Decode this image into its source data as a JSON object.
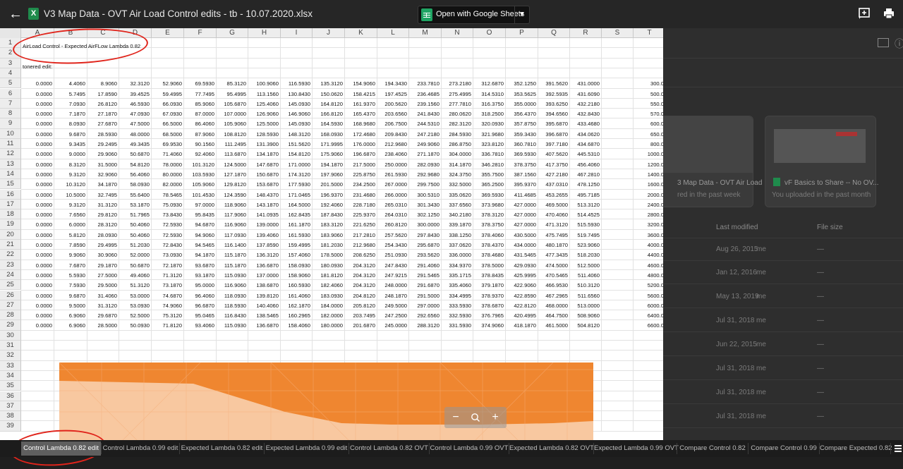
{
  "topbar": {
    "back_icon": "arrow-left-icon",
    "file_icon_letter": "X",
    "title": "V3 Map Data - OVT Air Load Control edits - tb - 10.07.2020.xlsx",
    "open_with_label": "Open with Google Sheets",
    "add_comment_icon": "add-comment-icon",
    "print_icon": "print-icon"
  },
  "sheet": {
    "columns": [
      "A",
      "B",
      "C",
      "D",
      "E",
      "F",
      "G",
      "H",
      "I",
      "J",
      "K",
      "L",
      "M",
      "N",
      "O",
      "P",
      "Q",
      "R",
      "S",
      "T"
    ],
    "row_numbers": [
      "1",
      "2",
      "3",
      "4",
      "5",
      "6",
      "7",
      "8",
      "9",
      "10",
      "11",
      "12",
      "13",
      "14",
      "15",
      "16",
      "17",
      "18",
      "19",
      "20",
      "21",
      "22",
      "23",
      "24",
      "25",
      "26",
      "27",
      "28",
      "29",
      "30",
      "31",
      "32",
      "33",
      "34",
      "35",
      "36",
      "37",
      "38",
      "39"
    ],
    "a1": "AirLoad Control - Expected AirFLow Lambda 0.82",
    "a3": "tonered edit:",
    "data_rows": [
      [
        "0.0000",
        "4.4060",
        "8.9060",
        "32.3120",
        "52.9060",
        "69.5930",
        "85.3120",
        "100.9060",
        "116.5930",
        "135.3120",
        "154.9060",
        "194.3430",
        "233.7810",
        "273.2180",
        "312.6870",
        "352.1250",
        "391.5620",
        "431.0000",
        "",
        "300.0"
      ],
      [
        "0.0000",
        "5.7495",
        "17.8590",
        "39.4525",
        "59.4995",
        "77.7495",
        "95.4995",
        "113.1560",
        "130.8430",
        "150.0620",
        "158.4215",
        "197.4525",
        "236.4685",
        "275.4995",
        "314.5310",
        "353.5625",
        "392.5935",
        "431.6090",
        "",
        "500.0"
      ],
      [
        "0.0000",
        "7.0930",
        "26.8120",
        "46.5930",
        "66.0930",
        "85.9060",
        "105.6870",
        "125.4060",
        "145.0930",
        "164.8120",
        "161.9370",
        "200.5620",
        "239.1560",
        "277.7810",
        "316.3750",
        "355.0000",
        "393.6250",
        "432.2180",
        "",
        "550.0"
      ],
      [
        "0.0000",
        "7.1870",
        "27.1870",
        "47.0930",
        "67.0930",
        "87.0000",
        "107.0000",
        "126.9060",
        "146.9060",
        "166.8120",
        "165.4370",
        "203.6560",
        "241.8430",
        "280.0620",
        "318.2500",
        "356.4370",
        "394.6560",
        "432.8430",
        "",
        "570.0"
      ],
      [
        "0.0000",
        "8.0930",
        "27.6870",
        "47.5000",
        "66.5000",
        "86.4060",
        "105.9060",
        "125.5000",
        "145.0930",
        "164.5930",
        "168.9680",
        "206.7500",
        "244.5310",
        "282.3120",
        "320.0930",
        "357.8750",
        "395.6870",
        "433.4680",
        "",
        "600.0"
      ],
      [
        "0.0000",
        "9.6870",
        "28.5930",
        "48.0000",
        "68.5000",
        "87.9060",
        "108.8120",
        "128.5930",
        "148.3120",
        "168.0930",
        "172.4680",
        "209.8430",
        "247.2180",
        "284.5930",
        "321.9680",
        "359.3430",
        "396.6870",
        "434.0620",
        "",
        "650.0"
      ],
      [
        "0.0000",
        "9.3435",
        "29.2495",
        "49.3435",
        "69.9530",
        "90.1560",
        "111.2495",
        "131.3900",
        "151.5620",
        "171.9995",
        "176.0000",
        "212.9680",
        "249.9060",
        "286.8750",
        "323.8120",
        "360.7810",
        "397.7180",
        "434.6870",
        "",
        "800.0"
      ],
      [
        "0.0000",
        "9.0000",
        "29.9060",
        "50.6870",
        "71.4060",
        "92.4060",
        "113.6870",
        "134.1870",
        "154.8120",
        "175.9060",
        "196.6870",
        "238.4060",
        "271.1870",
        "304.0000",
        "336.7810",
        "369.5930",
        "407.5620",
        "445.5310",
        "",
        "1000.0"
      ],
      [
        "0.0000",
        "8.3120",
        "31.5000",
        "54.8120",
        "78.0000",
        "101.3120",
        "124.5000",
        "147.6870",
        "171.0000",
        "194.1870",
        "217.5000",
        "250.0000",
        "282.0930",
        "314.1870",
        "346.2810",
        "378.3750",
        "417.3750",
        "456.4060",
        "",
        "1200.0"
      ],
      [
        "0.0000",
        "9.3120",
        "32.9060",
        "56.4060",
        "80.0000",
        "103.5930",
        "127.1870",
        "150.6870",
        "174.3120",
        "197.9060",
        "225.8750",
        "261.5930",
        "292.9680",
        "324.3750",
        "355.7500",
        "387.1560",
        "427.2180",
        "467.2810",
        "",
        "1400.0"
      ],
      [
        "0.0000",
        "10.3120",
        "34.1870",
        "58.0930",
        "82.0000",
        "105.9060",
        "129.8120",
        "153.6870",
        "177.5930",
        "201.5000",
        "234.2500",
        "267.0000",
        "299.7500",
        "332.5000",
        "365.2500",
        "395.9370",
        "437.0310",
        "478.1250",
        "",
        "1600.0"
      ],
      [
        "0.0000",
        "10.5000",
        "32.7495",
        "55.6400",
        "78.5465",
        "101.4530",
        "124.3590",
        "148.4370",
        "171.0465",
        "196.9370",
        "231.4680",
        "266.0000",
        "300.5310",
        "335.0620",
        "369.5930",
        "411.4685",
        "453.2655",
        "495.7185",
        "",
        "2000.0"
      ],
      [
        "0.0000",
        "9.3120",
        "31.3120",
        "53.1870",
        "75.0930",
        "97.0000",
        "118.9060",
        "143.1870",
        "164.5000",
        "192.4060",
        "228.7180",
        "265.0310",
        "301.3430",
        "337.6560",
        "373.9680",
        "427.0000",
        "469.5000",
        "513.3120",
        "",
        "2400.0"
      ],
      [
        "0.0000",
        "7.6560",
        "29.8120",
        "51.7965",
        "73.8430",
        "95.8435",
        "117.9060",
        "141.0935",
        "162.8435",
        "187.8430",
        "225.9370",
        "264.0310",
        "302.1250",
        "340.2180",
        "378.3120",
        "427.0000",
        "470.4060",
        "514.4525",
        "",
        "2800.0"
      ],
      [
        "0.0000",
        "6.0000",
        "28.3120",
        "50.4060",
        "72.5930",
        "94.6870",
        "116.9060",
        "139.0000",
        "161.1870",
        "183.3120",
        "221.6250",
        "260.8120",
        "300.0000",
        "339.1870",
        "378.3750",
        "427.0000",
        "471.3120",
        "515.5930",
        "",
        "3200.0"
      ],
      [
        "0.0000",
        "5.8120",
        "28.0930",
        "50.4060",
        "72.5930",
        "94.9060",
        "117.0930",
        "139.4060",
        "161.5930",
        "183.9060",
        "217.2810",
        "257.5620",
        "297.8430",
        "338.1250",
        "378.4060",
        "430.5000",
        "475.7495",
        "519.7495",
        "",
        "3600.0"
      ],
      [
        "0.0000",
        "7.8590",
        "29.4995",
        "51.2030",
        "72.8430",
        "94.5465",
        "116.1400",
        "137.8590",
        "159.4995",
        "181.2030",
        "212.9680",
        "254.3430",
        "295.6870",
        "337.0620",
        "378.4370",
        "434.0000",
        "480.1870",
        "523.9060",
        "",
        "4000.0"
      ],
      [
        "0.0000",
        "9.9060",
        "30.9060",
        "52.0000",
        "73.0930",
        "94.1870",
        "115.1870",
        "136.3120",
        "157.4060",
        "178.5000",
        "208.6250",
        "251.0930",
        "293.5620",
        "336.0000",
        "378.4680",
        "431.5465",
        "477.3435",
        "518.2030",
        "",
        "4400.0"
      ],
      [
        "0.0000",
        "7.6870",
        "29.1870",
        "50.6870",
        "72.1870",
        "93.6870",
        "115.1870",
        "136.6870",
        "158.0930",
        "180.0930",
        "204.3120",
        "247.8430",
        "291.4060",
        "334.9370",
        "378.5000",
        "429.0930",
        "474.5000",
        "512.5000",
        "",
        "4600.0"
      ],
      [
        "0.0000",
        "5.5930",
        "27.5000",
        "49.4060",
        "71.3120",
        "93.1870",
        "115.0930",
        "137.0000",
        "158.9060",
        "181.8120",
        "204.3120",
        "247.9215",
        "291.5465",
        "335.1715",
        "378.8435",
        "425.9995",
        "470.5465",
        "511.4060",
        "",
        "4800.0"
      ],
      [
        "0.0000",
        "7.5930",
        "29.5000",
        "51.3120",
        "73.1870",
        "95.0000",
        "116.9060",
        "138.6870",
        "160.5930",
        "182.4060",
        "204.3120",
        "248.0000",
        "291.6870",
        "335.4060",
        "379.1870",
        "422.9060",
        "466.9530",
        "510.3120",
        "",
        "5200.0"
      ],
      [
        "0.0000",
        "9.6870",
        "31.4060",
        "53.0000",
        "74.6870",
        "96.4060",
        "118.0930",
        "139.8120",
        "161.4060",
        "183.0930",
        "204.8120",
        "248.1870",
        "291.5000",
        "334.4995",
        "378.9370",
        "422.8590",
        "467.2965",
        "511.6560",
        "",
        "5600.0"
      ],
      [
        "0.0000",
        "9.5000",
        "31.3120",
        "53.0930",
        "74.9060",
        "96.6870",
        "118.5930",
        "140.4060",
        "162.1870",
        "184.0000",
        "205.8120",
        "249.5000",
        "297.0000",
        "333.5930",
        "378.6870",
        "422.8120",
        "468.0000",
        "513.0000",
        "",
        "6000.0"
      ],
      [
        "0.0000",
        "6.9060",
        "29.6870",
        "52.5000",
        "75.3120",
        "95.0465",
        "116.8430",
        "138.5465",
        "160.2965",
        "182.0000",
        "203.7495",
        "247.2500",
        "292.6560",
        "332.5930",
        "376.7965",
        "420.4995",
        "464.7500",
        "508.9060",
        "",
        "6400.0"
      ],
      [
        "0.0000",
        "6.9060",
        "28.5000",
        "50.0930",
        "71.8120",
        "93.4060",
        "115.0930",
        "136.6870",
        "158.4060",
        "180.0000",
        "201.6870",
        "245.0000",
        "288.3120",
        "331.5930",
        "374.9060",
        "418.1870",
        "461.5000",
        "504.8120",
        "",
        "6600.0"
      ]
    ]
  },
  "zoom_controls": {
    "minus": "−",
    "search_icon": "magnifier-icon",
    "plus": "+"
  },
  "drive_bg": {
    "card1_title": "3 Map Data - OVT Air Load ...",
    "card1_sub": "red in the past week",
    "card2_title": "vF Basics to Share -- No OV...",
    "card2_sub": "You uploaded in the past month",
    "col_last_modified": "Last modified",
    "col_file_size": "File size",
    "rows": [
      {
        "date": "Aug 26, 2015",
        "owner": "me",
        "size": "—"
      },
      {
        "date": "Jan 12, 2016",
        "owner": "me",
        "size": "—"
      },
      {
        "date": "May 13, 2019",
        "owner": "me",
        "size": "—"
      },
      {
        "date": "Jul 31, 2018",
        "owner": "me",
        "size": "—"
      },
      {
        "date": "Jun 22, 2015",
        "owner": "me",
        "size": "—"
      },
      {
        "date": "Jul 31, 2018",
        "owner": "me",
        "size": "—"
      },
      {
        "date": "Jul 31, 2018",
        "owner": "me",
        "size": "—"
      },
      {
        "date": "Jul 31, 2018",
        "owner": "me",
        "size": "—"
      }
    ]
  },
  "tabs": [
    "Control Lambda 0.82 edit",
    "Control Lambda 0.99 edit",
    "Expected Lambda 0.82 edit",
    "Expected Lambda 0.99 edit",
    "Control Lambda 0.82 OVT",
    "Control Lambda 0.99 OVT",
    "Expected Lambda 0.82 OVT",
    "Expected Lambda 0.99 OVT",
    "Compare Control 0.82",
    "Compare Control 0.99",
    "Compare Expected 0.82"
  ],
  "active_tab_index": 0,
  "colors": {
    "annotation": "#e0241b",
    "chart_orange": "#f08a2c",
    "chart_light": "#f8c8a0",
    "sheets_green": "#1fa463",
    "excel_green": "#1f8b4c"
  }
}
